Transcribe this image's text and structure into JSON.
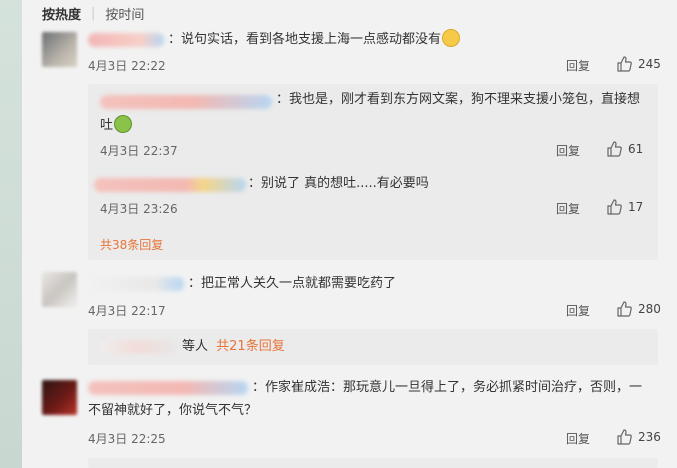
{
  "sort": {
    "hot": "按热度",
    "time": "按时间"
  },
  "comments": [
    {
      "text": "：说句实话，看到各地支援上海一点感动都没有",
      "time": "4月3日 22:22",
      "reply": "回复",
      "likes": "245",
      "subs": [
        {
          "text": "：我也是，刚才看到东方网文案，狗不理来支援小笼包，直接想",
          "text2": "吐",
          "time": "4月3日 22:37",
          "reply": "回复",
          "likes": "61"
        },
        {
          "text": "：别说了 真的想吐.....有必要吗",
          "time": "4月3日 23:26",
          "reply": "回复",
          "likes": "17"
        }
      ],
      "more": "共38条回复"
    },
    {
      "text": "：把正常人关久一点就都需要吃药了",
      "time": "4月3日 22:17",
      "reply": "回复",
      "likes": "280",
      "sub_summary": {
        "text": "等人",
        "more": "共21条回复"
      }
    },
    {
      "text": "：作家崔成浩：那玩意儿一旦得上了，务必抓紧时间治疗，否则，一",
      "text2": "不留神就好了，你说气不气？",
      "time": "4月3日 22:25",
      "reply": "回复",
      "likes": "236"
    }
  ],
  "icons": {
    "like": "thumbs-up-icon",
    "emoji1": "surprised-face-icon",
    "emoji2": "sick-face-icon"
  }
}
